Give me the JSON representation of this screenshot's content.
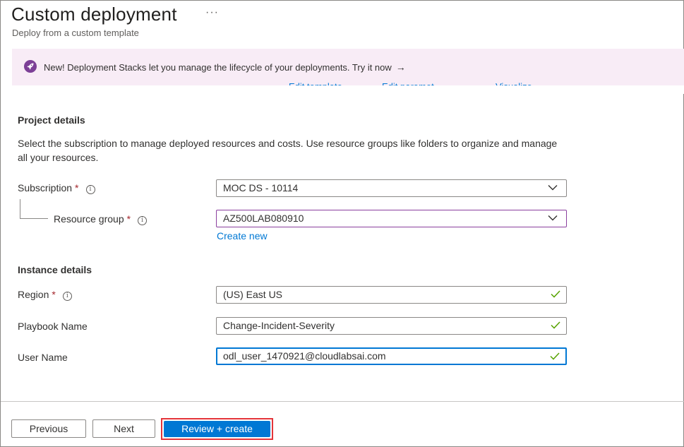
{
  "header": {
    "title": "Custom deployment",
    "more_label": "···",
    "subtitle": "Deploy from a custom template"
  },
  "banner": {
    "icon": "rocket-icon",
    "text": "New! Deployment Stacks let you manage the lifecycle of your deployments. Try it now",
    "arrow": "→"
  },
  "template_links": {
    "edit_template": "Edit template",
    "edit_parameters": "Edit paramet...",
    "visualize": "Visualize"
  },
  "project": {
    "heading": "Project details",
    "description": "Select the subscription to manage deployed resources and costs. Use resource groups like folders to organize and manage all your resources.",
    "subscription_label": "Subscription",
    "subscription_value": "MOC DS - 10114",
    "resource_group_label": "Resource group",
    "resource_group_value": "AZ500LAB080910",
    "create_new": "Create new",
    "required_mark": "*",
    "info_mark": "i"
  },
  "instance": {
    "heading": "Instance details",
    "region_label": "Region",
    "region_value": "(US) East US",
    "playbook_label": "Playbook Name",
    "playbook_value": "Change-Incident-Severity",
    "username_label": "User Name",
    "username_value": "odl_user_1470921@cloudlabsai.com"
  },
  "footer": {
    "previous": "Previous",
    "next": "Next",
    "review_create": "Review + create"
  },
  "colors": {
    "accent": "#0078d4",
    "required": "#a4262c",
    "valid_check": "#57a300",
    "banner_bg": "#f8ecf6",
    "highlight": "#e3343a"
  }
}
